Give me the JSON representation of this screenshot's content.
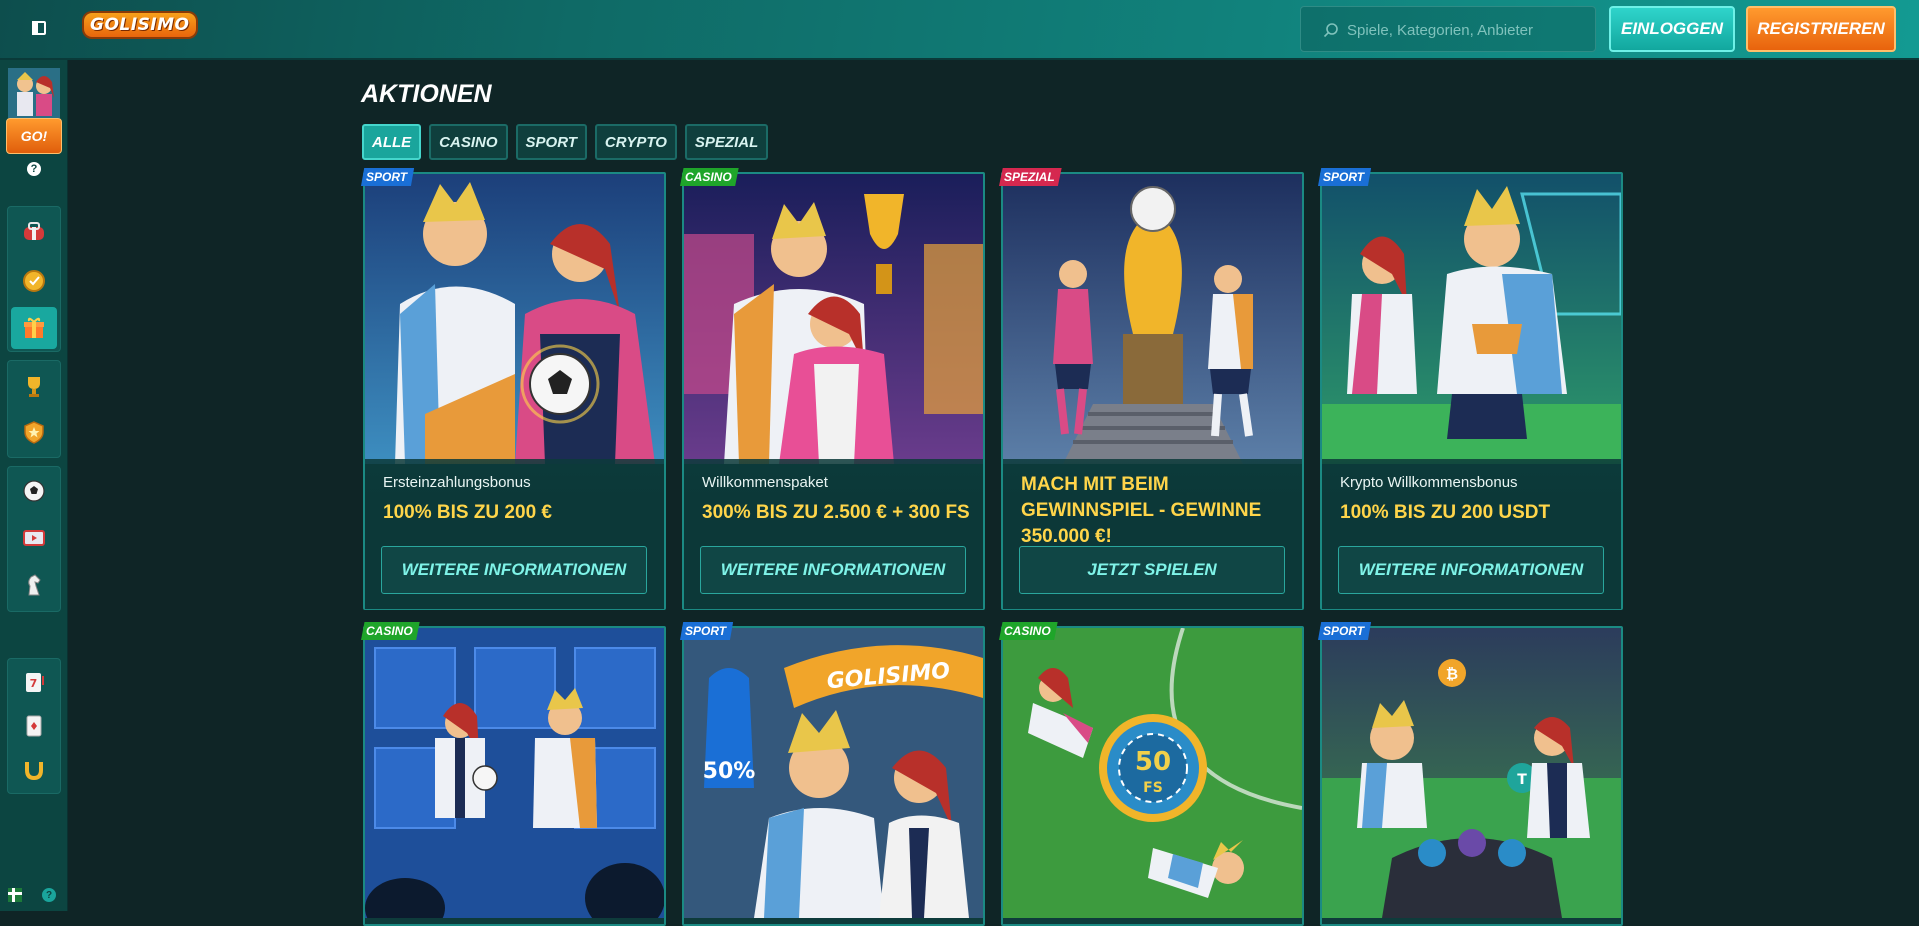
{
  "header": {
    "logo_text": "GOLISIMO",
    "search_placeholder": "Spiele, Kategorien, Anbieter",
    "login_label": "EINLOGGEN",
    "register_label": "REGISTRIEREN"
  },
  "sidebar": {
    "go_label": "GO!",
    "help_label": "?",
    "items": [
      {
        "icon": "bag-icon"
      },
      {
        "icon": "coin-icon"
      },
      {
        "icon": "gift-icon",
        "active": true
      },
      {
        "icon": "trophy-icon"
      },
      {
        "icon": "shield-icon"
      },
      {
        "icon": "football-icon"
      },
      {
        "icon": "live-tv-icon"
      },
      {
        "icon": "horse-icon"
      },
      {
        "icon": "slot-icon"
      },
      {
        "icon": "card-icon"
      },
      {
        "icon": "horseshoe-icon"
      }
    ]
  },
  "main": {
    "title": "AKTIONEN",
    "filters": [
      {
        "label": "ALLE",
        "active": true
      },
      {
        "label": "CASINO"
      },
      {
        "label": "SPORT"
      },
      {
        "label": "CRYPTO"
      },
      {
        "label": "SPEZIAL"
      }
    ],
    "cards": [
      {
        "badge": "SPORT",
        "subtitle": "Ersteinzahlungsbonus",
        "headline": "100% BIS ZU 200 €",
        "cta": "WEITERE INFORMATIONEN"
      },
      {
        "badge": "CASINO",
        "subtitle": "Willkommenspaket",
        "headline": "300% BIS ZU 2.500 € + 300 FS",
        "cta": "WEITERE INFORMATIONEN"
      },
      {
        "badge": "SPEZIAL",
        "subtitle": "",
        "headline": "MACH MIT BEIM GEWINNSPIEL - GEWINNE 350.000 €!",
        "cta": "JETZT SPIELEN"
      },
      {
        "badge": "SPORT",
        "subtitle": "Krypto Willkommensbonus",
        "headline": "100% BIS ZU 200 USDT",
        "cta": "WEITERE INFORMATIONEN"
      },
      {
        "badge": "CASINO"
      },
      {
        "badge": "SPORT",
        "art_text": "GOLISIMO",
        "art_number": "50%"
      },
      {
        "badge": "CASINO",
        "art_number": "50",
        "art_suffix": "FS"
      },
      {
        "badge": "SPORT"
      }
    ]
  },
  "colors": {
    "accent": "#1aa59c",
    "cta_text": "#7ff3e8",
    "headline": "#ffd54a",
    "register": "#ff9a2e",
    "sport_badge": "#1a6fd6",
    "casino_badge": "#1fa52a",
    "spezial_badge": "#d5284f"
  }
}
